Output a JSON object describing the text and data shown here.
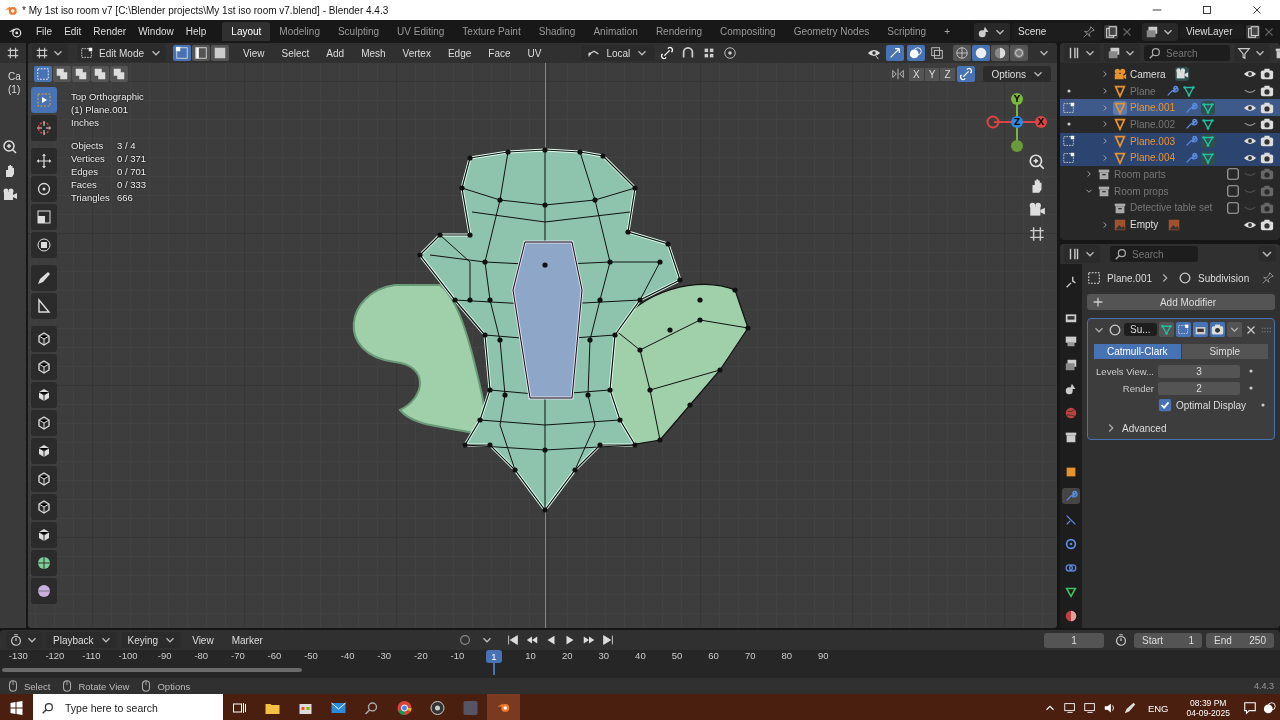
{
  "window": {
    "title": "* My 1st iso room v7 [C:\\Blender projects\\My 1st iso room v7.blend] - Blender 4.4.3"
  },
  "menu": [
    "File",
    "Edit",
    "Render",
    "Window",
    "Help"
  ],
  "workspaces": [
    {
      "label": "Layout",
      "selected": true
    },
    {
      "label": "Modeling",
      "selected": false
    },
    {
      "label": "Sculpting",
      "selected": false
    },
    {
      "label": "UV Editing",
      "selected": false
    },
    {
      "label": "Texture Paint",
      "selected": false
    },
    {
      "label": "Shading",
      "selected": false
    },
    {
      "label": "Animation",
      "selected": false
    },
    {
      "label": "Rendering",
      "selected": false
    },
    {
      "label": "Compositing",
      "selected": false
    },
    {
      "label": "Geometry Nodes",
      "selected": false
    },
    {
      "label": "Scripting",
      "selected": false
    }
  ],
  "add_workspace": "+",
  "scene": "Scene",
  "view_layer": "ViewLayer",
  "side_strip": {
    "label": "Ca",
    "frame": "(1)"
  },
  "viewport": {
    "mode": "Edit Mode",
    "select_modes": [
      {
        "selected": true
      },
      {
        "selected": false
      },
      {
        "selected": false
      }
    ],
    "menus": [
      "View",
      "Select",
      "Add",
      "Mesh",
      "Vertex",
      "Edge",
      "Face",
      "UV"
    ],
    "orientation": "Local",
    "shading": [
      {
        "selected": false
      },
      {
        "selected": true
      },
      {
        "selected": false
      },
      {
        "selected": false
      }
    ],
    "box_modes": [
      {
        "selected": true
      },
      {
        "selected": false
      },
      {
        "selected": false
      },
      {
        "selected": false
      },
      {
        "selected": false
      }
    ],
    "mirror_axes": [
      "X",
      "Y",
      "Z"
    ],
    "options": "Options",
    "overlay": {
      "view": "Top Orthographic",
      "object": "(1) Plane.001",
      "units": "Inches",
      "stats": [
        {
          "label": "Objects",
          "value": "3 / 4"
        },
        {
          "label": "Vertices",
          "value": "0 / 371"
        },
        {
          "label": "Edges",
          "value": "0 / 701"
        },
        {
          "label": "Faces",
          "value": "0 / 333"
        },
        {
          "label": "Triangles",
          "value": "666"
        }
      ]
    },
    "tools": [
      {
        "selected": true
      },
      {
        "selected": false
      },
      {
        "selected": false
      },
      {
        "selected": false
      },
      {
        "selected": false
      },
      {
        "selected": false
      },
      {
        "selected": false
      },
      {
        "selected": false
      },
      {
        "selected": false
      },
      {
        "selected": false
      },
      {
        "selected": false
      },
      {
        "selected": false
      },
      {
        "selected": false
      },
      {
        "selected": false
      },
      {
        "selected": false
      },
      {
        "selected": false
      },
      {
        "selected": false
      },
      {
        "selected": false
      }
    ],
    "gizmo_axes": [
      "Y",
      "Z",
      "X"
    ]
  },
  "outliner": {
    "search_placeholder": "Search",
    "items": [
      {
        "name": "Camera",
        "kind": "camera",
        "selected": false,
        "active": false,
        "visible": true
      },
      {
        "name": "Plane",
        "kind": "mesh",
        "selected": false,
        "active": false,
        "visible": false
      },
      {
        "name": "Plane.001",
        "kind": "mesh",
        "selected": true,
        "active": true,
        "visible": true
      },
      {
        "name": "Plane.002",
        "kind": "mesh",
        "selected": false,
        "active": false,
        "visible": false
      },
      {
        "name": "Plane.003",
        "kind": "mesh",
        "selected": true,
        "active": false,
        "visible": true
      },
      {
        "name": "Plane.004",
        "kind": "mesh",
        "selected": true,
        "active": false,
        "visible": true
      },
      {
        "name": "Room parts",
        "kind": "collection",
        "checked": false,
        "expanded": false
      },
      {
        "name": "Room props",
        "kind": "collection",
        "checked": false,
        "expanded": true,
        "children": [
          {
            "name": "Detective table set",
            "kind": "collection",
            "checked": false
          }
        ]
      },
      {
        "name": "Empty",
        "kind": "empty",
        "selected": false,
        "active": false,
        "visible": true
      }
    ]
  },
  "properties": {
    "search_placeholder": "Search",
    "tabs": [
      {
        "selected": false
      },
      {
        "selected": false
      },
      {
        "selected": false
      },
      {
        "selected": false
      },
      {
        "selected": false
      },
      {
        "selected": false
      },
      {
        "selected": false
      },
      {
        "selected": false
      },
      {
        "selected": true
      },
      {
        "selected": false
      },
      {
        "selected": false
      },
      {
        "selected": false
      },
      {
        "selected": false
      },
      {
        "selected": false
      }
    ],
    "breadcrumb": [
      "Plane.001",
      "Subdivision"
    ],
    "add_modifier": "Add Modifier",
    "modifier": {
      "name": "Su...",
      "expanded": true,
      "types": [
        {
          "label": "Catmull-Clark",
          "selected": true
        },
        {
          "label": "Simple",
          "selected": false
        }
      ],
      "fields": [
        {
          "label": "Levels View...",
          "value": "3"
        },
        {
          "label": "Render",
          "value": "2"
        }
      ],
      "optimal_display": {
        "label": "Optimal Display",
        "checked": true
      },
      "advanced": {
        "label": "Advanced",
        "expanded": false
      }
    }
  },
  "timeline": {
    "menus": [
      "Playback",
      "Keying",
      "View",
      "Marker"
    ],
    "current_frame": "1",
    "start_label": "Start",
    "start": "1",
    "end_label": "End",
    "end": "250",
    "ruler": [
      {
        "label": "-130",
        "current": false
      },
      {
        "label": "-120",
        "current": false
      },
      {
        "label": "-110",
        "current": false
      },
      {
        "label": "-100",
        "current": false
      },
      {
        "label": "-90",
        "current": false
      },
      {
        "label": "-80",
        "current": false
      },
      {
        "label": "-70",
        "current": false
      },
      {
        "label": "-60",
        "current": false
      },
      {
        "label": "-50",
        "current": false
      },
      {
        "label": "-40",
        "current": false
      },
      {
        "label": "-30",
        "current": false
      },
      {
        "label": "-20",
        "current": false
      },
      {
        "label": "-10",
        "current": false
      },
      {
        "label": "1",
        "current": true
      },
      {
        "label": "10",
        "current": false
      },
      {
        "label": "20",
        "current": false
      },
      {
        "label": "30",
        "current": false
      },
      {
        "label": "40",
        "current": false
      },
      {
        "label": "50",
        "current": false
      },
      {
        "label": "60",
        "current": false
      },
      {
        "label": "70",
        "current": false
      },
      {
        "label": "80",
        "current": false
      },
      {
        "label": "90",
        "current": false
      }
    ]
  },
  "status_bar": {
    "hints": [
      "Select",
      "Rotate View",
      "Options"
    ],
    "version": "4.4.3"
  },
  "taskbar": {
    "search_placeholder": "Type here to search",
    "language": "ENG",
    "time": "08:39 PM",
    "date": "04-09-2025"
  }
}
